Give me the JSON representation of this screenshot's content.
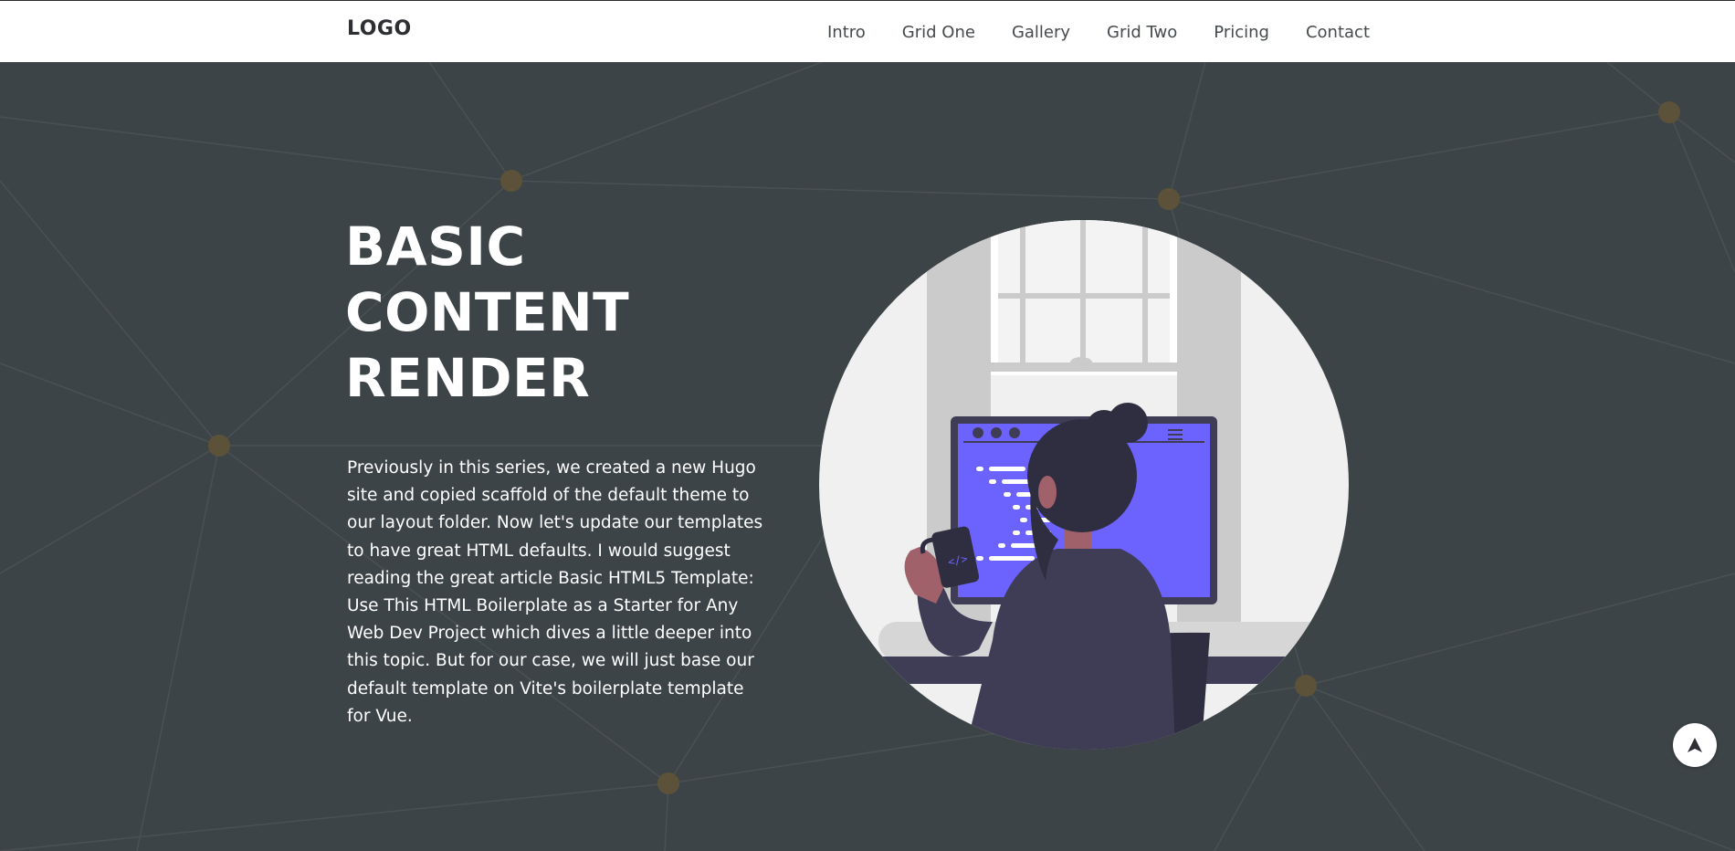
{
  "header": {
    "logo": "LOGO",
    "nav": [
      "Intro",
      "Grid One",
      "Gallery",
      "Grid Two",
      "Pricing",
      "Contact"
    ]
  },
  "hero": {
    "title_lines": [
      "BASIC",
      "CONTENT",
      "RENDER"
    ],
    "body": "Previously in this series, we created a new Hugo site and copied scaffold of the default theme to our layout folder. Now let's update our templates to have great HTML defaults. I would suggest reading the great article Basic HTML5 Template: Use This HTML Boilerplate as a Starter for Any Web Dev Project which dives a little deeper into this topic. But for our case, we will just base our default template on Vite's boilerplate template for Vue.",
    "illustration_icon": "developer-at-computer-illustration"
  },
  "scroll_top": {
    "icon": "arrow-up-icon"
  },
  "colors": {
    "background": "#3d4447",
    "navbar": "#ffffff",
    "text_dark": "#2e2f33",
    "accent_purple": "#6c63ff",
    "network_dot": "#5b5239",
    "network_line": "#4a5153"
  }
}
